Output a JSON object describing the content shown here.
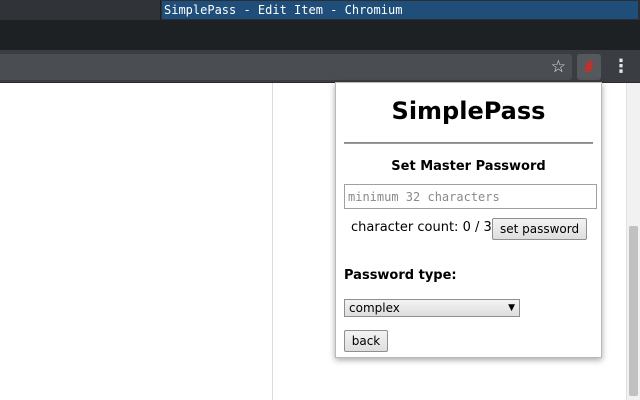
{
  "window": {
    "title": "SimplePass - Edit Item - Chromium"
  },
  "toolbar": {
    "star_icon": "☆",
    "extension_icon": "#",
    "menu_icon": "⋮"
  },
  "popup": {
    "title": "SimplePass",
    "master_heading": "Set Master Password",
    "password_placeholder": "minimum 32 characters",
    "character_count_label": "character count: 0 / 32",
    "set_password_button": "set password",
    "password_type_label": "Password type:",
    "password_type_selected": "complex",
    "back_button": "back"
  },
  "colors": {
    "extension_icon": "#e0251b",
    "active_title_bg": "#1f4e7a"
  }
}
